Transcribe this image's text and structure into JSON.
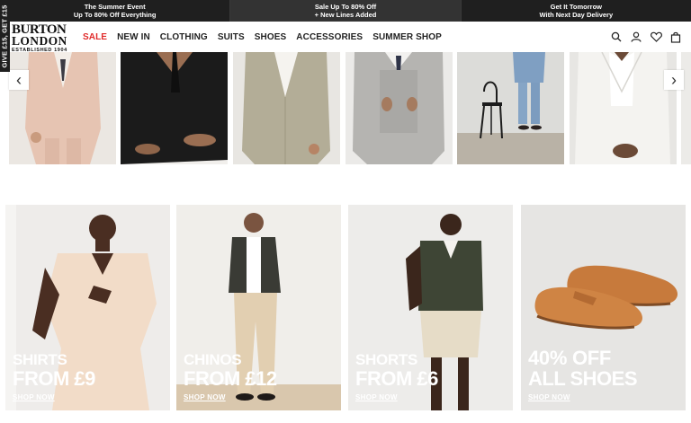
{
  "side_tab": {
    "label": "GIVE £15, GET £15"
  },
  "promo": [
    {
      "line1": "The Summer Event",
      "line2": "Up To 80% Off Everything"
    },
    {
      "line1": "Sale Up To 80% Off",
      "line2": "+ New Lines Added"
    },
    {
      "line1": "Get It Tomorrow",
      "line2": "With Next Day Delivery"
    }
  ],
  "logo": {
    "line1": "BURTON",
    "line2": "LONDON",
    "line3": "ESTABLISHED 1904"
  },
  "nav": {
    "items": [
      "SALE",
      "NEW IN",
      "CLOTHING",
      "SUITS",
      "SHOES",
      "ACCESSORIES",
      "SUMMER SHOP"
    ],
    "sale_color": "#e02a2a"
  },
  "header_icons": [
    "search-icon",
    "account-icon",
    "wishlist-heart-icon",
    "bag-icon"
  ],
  "carousel": {
    "arrows": {
      "prev": "‹",
      "next": "›"
    },
    "tiles": [
      {
        "desc": "pink suit"
      },
      {
        "desc": "black suit"
      },
      {
        "desc": "sage suit"
      },
      {
        "desc": "grey check suit"
      },
      {
        "desc": "blue suit with chair"
      },
      {
        "desc": "white linen suit"
      }
    ]
  },
  "categories": [
    {
      "line1": "SHIRTS",
      "line2": "FROM £9",
      "cta": "SHOP NOW"
    },
    {
      "line1": "CHINOS",
      "line2": "FROM £12",
      "cta": "SHOP NOW"
    },
    {
      "line1": "SHORTS",
      "line2": "FROM £6",
      "cta": "SHOP NOW"
    },
    {
      "line1": "40% OFF",
      "line2": "ALL SHOES",
      "cta": "SHOP NOW"
    }
  ],
  "colors": {
    "promo_bg": "#1f1f1f",
    "promo_mid_bg": "#333333",
    "accent_red": "#e02a2a"
  }
}
